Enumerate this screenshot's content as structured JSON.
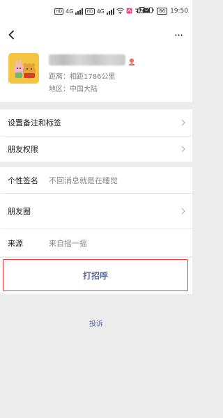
{
  "status_bar": {
    "sim1": "HD",
    "sim2": "HD",
    "net1": "4G",
    "net2": "4G",
    "time": "19:50",
    "battery": "86"
  },
  "profile": {
    "distance_label": "距离：",
    "distance_value": "相距1786公里",
    "region_label": "地区：",
    "region_value": "中国大陆"
  },
  "menu": {
    "remark_tags": "设置备注和标签",
    "friend_permissions": "朋友权限"
  },
  "details": {
    "signature_label": "个性签名",
    "signature_value": "不回消息就是在睡觉",
    "moments_label": "朋友圈",
    "source_label": "来源",
    "source_value": "来自摇一摇"
  },
  "actions": {
    "greet_label": "打招呼",
    "report_label": "投诉"
  },
  "colors": {
    "link": "#576b95",
    "highlight_border": "#e53935",
    "gender_female": "#f26b5b",
    "background": "#ececec"
  }
}
